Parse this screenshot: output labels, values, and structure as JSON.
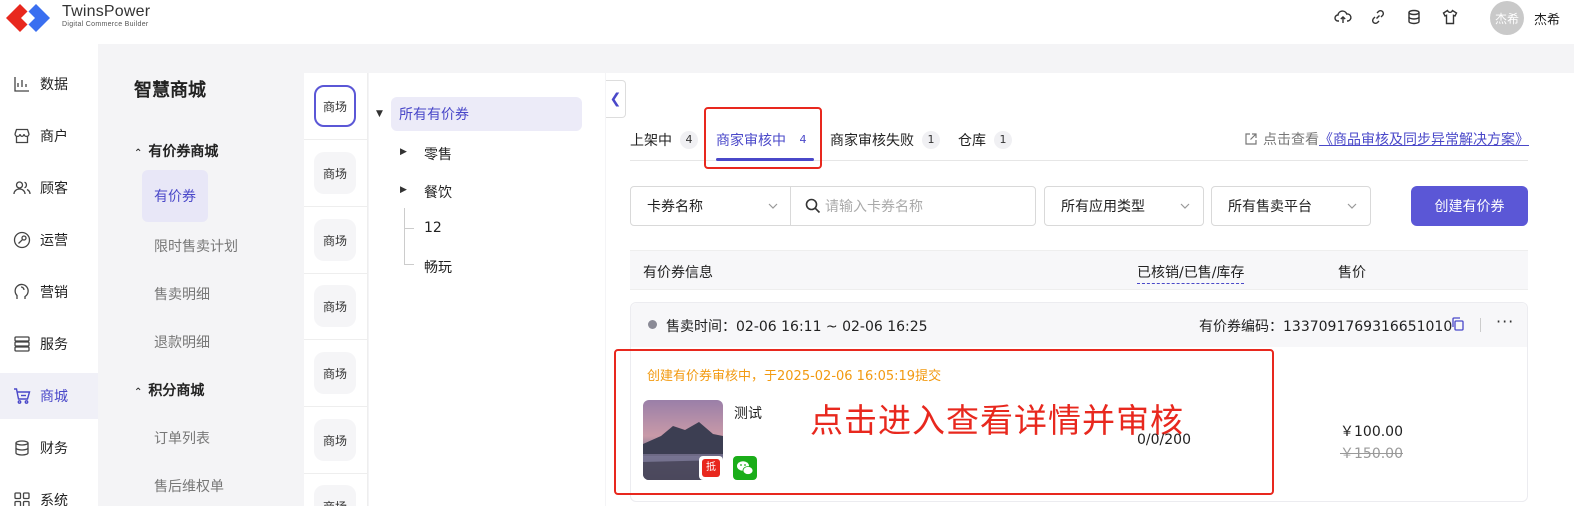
{
  "brand": {
    "name": "TwinsPower",
    "subtitle": "Digital Commerce Builder"
  },
  "user": {
    "avatar_text": "杰希",
    "name": "杰希"
  },
  "nav": [
    {
      "label": "数据",
      "icon": "chart-icon"
    },
    {
      "label": "商户",
      "icon": "store-icon"
    },
    {
      "label": "顾客",
      "icon": "users-icon"
    },
    {
      "label": "运营",
      "icon": "operation-icon"
    },
    {
      "label": "营销",
      "icon": "marketing-icon"
    },
    {
      "label": "服务",
      "icon": "service-icon"
    },
    {
      "label": "商城",
      "icon": "cart-icon"
    },
    {
      "label": "财务",
      "icon": "finance-icon"
    },
    {
      "label": "系统",
      "icon": "grid-icon"
    }
  ],
  "subnav": {
    "title": "智慧商城",
    "groups": [
      {
        "label": "有价券商城",
        "items": [
          "有价券",
          "限时售卖计划",
          "售卖明细",
          "退款明细"
        ]
      },
      {
        "label": "积分商城",
        "items": [
          "订单列表",
          "售后维权单"
        ]
      }
    ]
  },
  "malls": [
    "商场",
    "商场",
    "商场",
    "商场",
    "商场",
    "商场",
    "商场"
  ],
  "tree": {
    "root": "所有有价券",
    "children": [
      "零售",
      "餐饮",
      "12",
      "畅玩"
    ]
  },
  "tabs": [
    {
      "label": "上架中",
      "count": "4"
    },
    {
      "label": "商家审核中",
      "count": "4"
    },
    {
      "label": "商家审核失败",
      "count": "1"
    },
    {
      "label": "仓库",
      "count": "1"
    }
  ],
  "help": {
    "prefix": "点击查看",
    "doc": "《商品审核及同步异常解决方案》"
  },
  "filters": {
    "field": "卡券名称",
    "search_placeholder": "请输入卡券名称",
    "app_type": "所有应用类型",
    "platform": "所有售卖平台",
    "create": "创建有价券"
  },
  "table": {
    "headers": [
      "有价券信息",
      "已核销/已售/库存",
      "售价"
    ],
    "rows": [
      {
        "sale_time": "售卖时间：02-06 16:11 ~ 02-06 16:25",
        "code": "有价券编码：1337091769316651010",
        "more": "···",
        "review_note": "创建有价券审核中，于2025-02-06 16:05:19提交",
        "coupon_badge": "抵",
        "name": "测试",
        "stock": "0/0/200",
        "price": "￥100.00",
        "original_price": "￥150.00"
      }
    ]
  },
  "annotation": "点击进入查看详情并审核",
  "colors": {
    "accent": "#5b57d6",
    "annotation": "#e8281e",
    "warning": "#f29a11"
  }
}
